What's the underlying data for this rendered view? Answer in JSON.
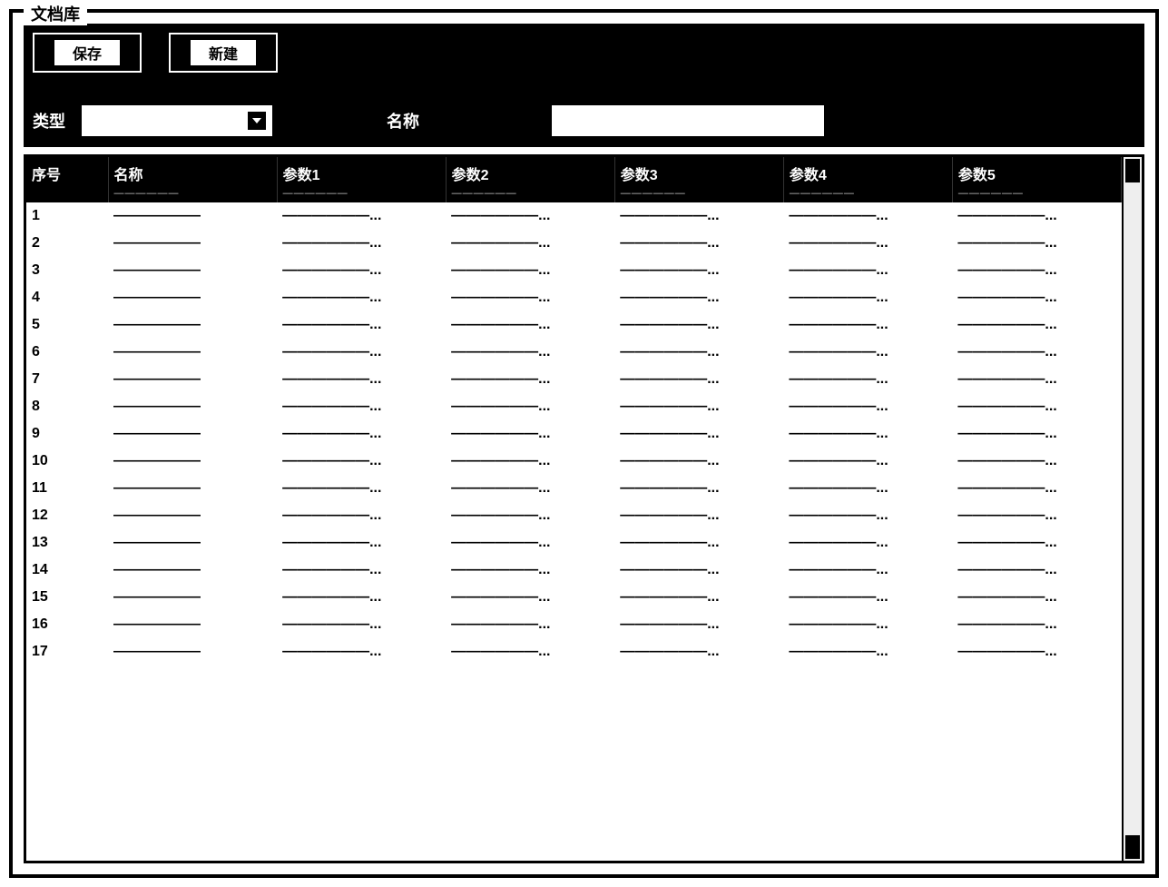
{
  "window": {
    "title": "文档库"
  },
  "toolbar": {
    "save_label": "保存",
    "new_label": "新建"
  },
  "filter": {
    "type_label": "类型",
    "type_value": "",
    "name_label": "名称",
    "name_value": ""
  },
  "table": {
    "columns": [
      "序号",
      "名称",
      "参数1",
      "参数2",
      "参数3",
      "参数4",
      "参数5"
    ],
    "sub_header": [
      "",
      "——————",
      "——————",
      "——————",
      "——————",
      "——————",
      "——————"
    ],
    "rows": [
      {
        "idx": "1",
        "v": [
          "——————",
          "——————...",
          "——————...",
          "——————...",
          "——————...",
          "——————..."
        ]
      },
      {
        "idx": "2",
        "v": [
          "——————",
          "——————...",
          "——————...",
          "——————...",
          "——————...",
          "——————..."
        ]
      },
      {
        "idx": "3",
        "v": [
          "——————",
          "——————...",
          "——————...",
          "——————...",
          "——————...",
          "——————..."
        ]
      },
      {
        "idx": "4",
        "v": [
          "——————",
          "——————...",
          "——————...",
          "——————...",
          "——————...",
          "——————..."
        ]
      },
      {
        "idx": "5",
        "v": [
          "——————",
          "——————...",
          "——————...",
          "——————...",
          "——————...",
          "——————..."
        ]
      },
      {
        "idx": "6",
        "v": [
          "——————",
          "——————...",
          "——————...",
          "——————...",
          "——————...",
          "——————..."
        ]
      },
      {
        "idx": "7",
        "v": [
          "——————",
          "——————...",
          "——————...",
          "——————...",
          "——————...",
          "——————..."
        ]
      },
      {
        "idx": "8",
        "v": [
          "——————",
          "——————...",
          "——————...",
          "——————...",
          "——————...",
          "——————..."
        ]
      },
      {
        "idx": "9",
        "v": [
          "——————",
          "——————...",
          "——————...",
          "——————...",
          "——————...",
          "——————..."
        ]
      },
      {
        "idx": "10",
        "v": [
          "——————",
          "——————...",
          "——————...",
          "——————...",
          "——————...",
          "——————..."
        ]
      },
      {
        "idx": "11",
        "v": [
          "——————",
          "——————...",
          "——————...",
          "——————...",
          "——————...",
          "——————..."
        ]
      },
      {
        "idx": "12",
        "v": [
          "——————",
          "——————...",
          "——————...",
          "——————...",
          "——————...",
          "——————..."
        ]
      },
      {
        "idx": "13",
        "v": [
          "——————",
          "——————...",
          "——————...",
          "——————...",
          "——————...",
          "——————..."
        ]
      },
      {
        "idx": "14",
        "v": [
          "——————",
          "——————...",
          "——————...",
          "——————...",
          "——————...",
          "——————..."
        ]
      },
      {
        "idx": "15",
        "v": [
          "——————",
          "——————...",
          "——————...",
          "——————...",
          "——————...",
          "——————..."
        ]
      },
      {
        "idx": "16",
        "v": [
          "——————",
          "——————...",
          "——————...",
          "——————...",
          "——————...",
          "——————..."
        ]
      },
      {
        "idx": "17",
        "v": [
          "——————",
          "——————...",
          "——————...",
          "——————...",
          "——————...",
          "——————..."
        ]
      }
    ]
  }
}
